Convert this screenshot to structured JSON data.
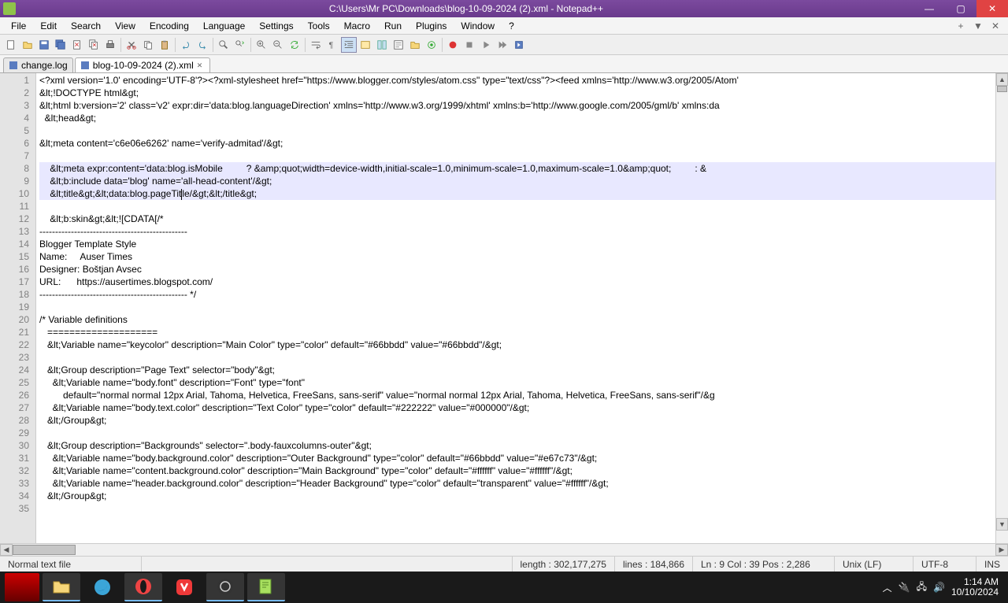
{
  "window": {
    "title": "C:\\Users\\Mr PC\\Downloads\\blog-10-09-2024 (2).xml - Notepad++"
  },
  "menu": {
    "items": [
      "File",
      "Edit",
      "Search",
      "View",
      "Encoding",
      "Language",
      "Settings",
      "Tools",
      "Macro",
      "Run",
      "Plugins",
      "Window",
      "?"
    ]
  },
  "tabs": [
    {
      "label": "change.log",
      "active": false
    },
    {
      "label": "blog-10-09-2024 (2).xml",
      "active": true
    }
  ],
  "code": {
    "lines": [
      "<?xml version='1.0' encoding='UTF-8'?><?xml-stylesheet href=\"https://www.blogger.com/styles/atom.css\" type=\"text/css\"?><feed xmlns='http://www.w3.org/2005/Atom'",
      "&lt;!DOCTYPE html&gt;",
      "&lt;html b:version='2' class='v2' expr:dir='data:blog.languageDirection' xmlns='http://www.w3.org/1999/xhtml' xmlns:b='http://www.google.com/2005/gml/b' xmlns:da",
      "  &lt;head&gt;",
      "",
      "&lt;meta content='c6e06e6262' name='verify-admitad'/&gt;",
      "",
      "    &lt;meta expr:content='data:blog.isMobile         ? &amp;quot;width=device-width,initial-scale=1.0,minimum-scale=1.0,maximum-scale=1.0&amp;quot;         : &",
      "    &lt;b:include data='blog' name='all-head-content'/&gt;",
      "    &lt;title&gt;&lt;data:blog.pageTitle/&gt;&lt;/title&gt;",
      "",
      "    &lt;b:skin&gt;&lt;![CDATA[/*",
      "-----------------------------------------------",
      "Blogger Template Style",
      "Name:     Auser Times",
      "Designer: Boštjan Avsec",
      "URL:      https://ausertimes.blogspot.com/",
      "----------------------------------------------- */",
      "",
      "/* Variable definitions",
      "   ====================",
      "   &lt;Variable name=\"keycolor\" description=\"Main Color\" type=\"color\" default=\"#66bbdd\" value=\"#66bbdd\"/&gt;",
      "",
      "   &lt;Group description=\"Page Text\" selector=\"body\"&gt;",
      "     &lt;Variable name=\"body.font\" description=\"Font\" type=\"font\"",
      "         default=\"normal normal 12px Arial, Tahoma, Helvetica, FreeSans, sans-serif\" value=\"normal normal 12px Arial, Tahoma, Helvetica, FreeSans, sans-serif\"/&g",
      "     &lt;Variable name=\"body.text.color\" description=\"Text Color\" type=\"color\" default=\"#222222\" value=\"#000000\"/&gt;",
      "   &lt;/Group&gt;",
      "",
      "   &lt;Group description=\"Backgrounds\" selector=\".body-fauxcolumns-outer\"&gt;",
      "     &lt;Variable name=\"body.background.color\" description=\"Outer Background\" type=\"color\" default=\"#66bbdd\" value=\"#e67c73\"/&gt;",
      "     &lt;Variable name=\"content.background.color\" description=\"Main Background\" type=\"color\" default=\"#ffffff\" value=\"#ffffff\"/&gt;",
      "     &lt;Variable name=\"header.background.color\" description=\"Header Background\" type=\"color\" default=\"transparent\" value=\"#ffffff\"/&gt;",
      "   &lt;/Group&gt;",
      ""
    ],
    "highlighted_lines": [
      8,
      9,
      10
    ],
    "caret_line": 10,
    "caret_col": 39
  },
  "status": {
    "filetype": "Normal text file",
    "length": "length : 302,177,275",
    "lines": "lines : 184,866",
    "position": "Ln : 9   Col : 39   Pos : 2,286",
    "eol": "Unix (LF)",
    "encoding": "UTF-8",
    "mode": "INS"
  },
  "taskbar": {
    "time": "1:14 AM",
    "date": "10/10/2024"
  }
}
